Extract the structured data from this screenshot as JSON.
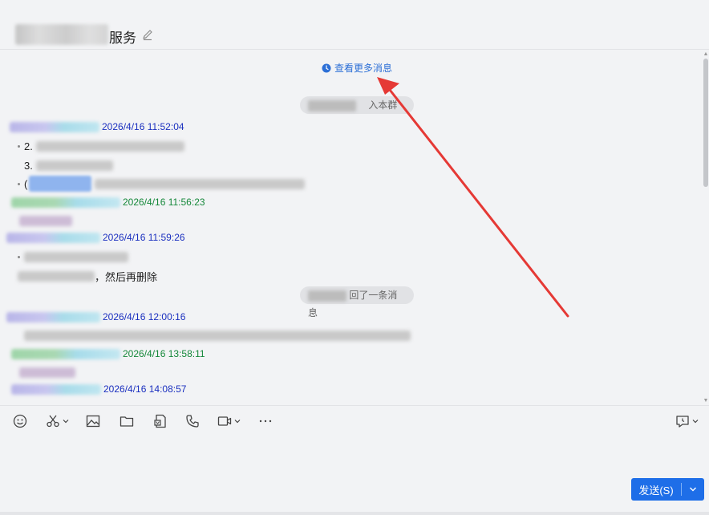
{
  "header": {
    "title_suffix": "服务"
  },
  "chat": {
    "view_more": "查看更多消息",
    "system_notices": [
      {
        "text": "入本群"
      },
      {
        "text": "回了一条消息"
      }
    ],
    "messages": [
      {
        "time": "2026/4/16 11:52:04",
        "lines": [
          "2.",
          "3.",
          "("
        ]
      },
      {
        "time": "2026/4/16 11:56:23"
      },
      {
        "time": "2026/4/16 11:59:26",
        "lines": [
          "",
          "，然后再删除"
        ]
      },
      {
        "time": "2026/4/16 12:00:16"
      },
      {
        "time": "2026/4/16 13:58:11"
      },
      {
        "time": "2026/4/16 14:08:57"
      }
    ]
  },
  "toolbar": {
    "icons": [
      "emoji-icon",
      "scissors-icon",
      "image-icon",
      "folder-icon",
      "document-icon",
      "phone-icon",
      "video-icon",
      "more-icon",
      "history-icon"
    ]
  },
  "input": {
    "send_label": "发送(S)"
  },
  "colors": {
    "link": "#2c6fd6",
    "send": "#1e6ee8",
    "arrow": "#e53935",
    "time_blue": "#1a2fbf",
    "time_green": "#15883a"
  }
}
